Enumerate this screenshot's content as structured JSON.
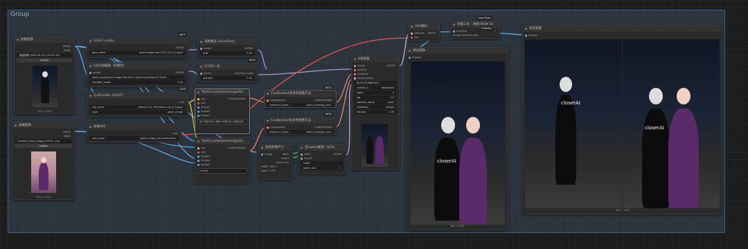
{
  "group": {
    "title": "Group"
  },
  "badges": {
    "gguf": "gguf",
    "beta1": "BETA",
    "beta2": "BETA",
    "beta3": "BETA",
    "layerstyle": "LayerStyle",
    "icnodes": "ICNodes",
    "gguf2": "GGUF"
  },
  "load_image1": {
    "title": "加载图像",
    "out_image": "IMAGE",
    "out_mask": "MASK",
    "file": "鼎盛视频_2025-08-16_0:25:22.78...",
    "upload": "upload",
    "size": "704 × 1216"
  },
  "load_image2": {
    "title": "加载图像",
    "id": "#0.2 DCC",
    "out_image": "IMAGE",
    "out_mask": "MASK",
    "file": "ComfyUI_temp_bbqqq_00010_.png",
    "upload": "upload",
    "size": "704 × 1216"
  },
  "gguf_loader": {
    "title": "GGUF Loader",
    "out": "MODEL",
    "field": "gguf_name",
    "value": "qwen-image-edit-2511-Q4_K_S.gguf"
  },
  "lora_loader": {
    "title": "LoRA加载器（仅模型）",
    "in": "model",
    "out": "MODEL",
    "lora": "qwen-local/Qwen-Image-Edit-2511-Lightning-4steps-V1.0-bf1...",
    "strength_label": "strength_model",
    "strength": "1.00"
  },
  "clip_loader": {
    "title": "CLIPLoader (GGUF)",
    "out": "CLIP",
    "clip_label": "clip_name",
    "clip": "Qwen2.5-VL-7B-Instruct-Q4_K_S.gguf",
    "type_label": "type",
    "type": "qwen_image"
  },
  "vae_loader": {
    "title": "加载VAE",
    "out": "VAE",
    "field": "vae_name",
    "value": "qwen_image_vae.safetensors"
  },
  "aura_flow": {
    "title": "采样算法 (AuraFlow)",
    "in": "model",
    "out": "MODEL",
    "shift_label": "shift",
    "shift": "3.00"
  },
  "cfg_norm": {
    "title": "CFG归一化",
    "in": "model",
    "out": "patched_model",
    "strength_label": "strength",
    "strength": "1.00"
  },
  "text_encode1": {
    "title": "TextEncodeQwenImageEdi...",
    "in_clip": "clip",
    "in_vae": "vae",
    "in_image1": "image1",
    "in_image2": "image2",
    "in_image3": "image3",
    "out": "CONDITIONING",
    "prompt": "将1号图中的人物和2号图中的人物放在同一场景中，两人比心...（中文）"
  },
  "text_encode2": {
    "title": "TextEncodeQwenImageEdi...",
    "in_clip": "clip",
    "in_vae": "vae",
    "in_image1": "image1",
    "in_image2": "image2",
    "in_image3": "image3",
    "out": "CONDITIONING",
    "prompt": "prompt"
  },
  "flux_ref1": {
    "title": "FluxKontext多参考图像方法",
    "in": "conditioning",
    "out": "CONDITIONING",
    "method_label": "reference_laten...",
    "method": "index_timestep_zero"
  },
  "flux_ref2": {
    "title": "FluxKontext多参考图像方法",
    "in": "conditioning",
    "out": "CONDITIONING",
    "method_label": "reference_laten...",
    "method": "index_timestep_zero"
  },
  "image_size": {
    "title": "获取图像尺寸",
    "in": "image",
    "out_w": "width",
    "out_h": "height",
    "out_b": "batch_size",
    "width_label": "width:",
    "width": "768_h",
    "height_label": "eight:",
    "height": "1376"
  },
  "empty_latent": {
    "title": "空Latent图像（SD3）",
    "in_w": "width",
    "in_h": "height",
    "out": "LATENT",
    "w_label": "width",
    "h_label": "height",
    "batch_label": "batch_size",
    "batch": "1"
  },
  "ksampler": {
    "title": "K采样器",
    "in_model": "model",
    "in_pos": "positive",
    "in_neg": "negative",
    "in_latent": "latent_image",
    "out": "LATENT",
    "seed": "823312156890017",
    "control_label": "control_a...",
    "control": "randomize",
    "steps_label": "steps",
    "steps": "4",
    "cfg_label": "cfg",
    "cfg": "1.0",
    "sampler_label": "sampler_name",
    "sampler": "euler",
    "scheduler_label": "scheduler",
    "scheduler": "simple",
    "denoise_label": "denoise",
    "denoise": "1.00"
  },
  "vae_decode": {
    "title": "VAE解码",
    "in_samples": "samples",
    "in_vae": "vae",
    "out": "IMAGE"
  },
  "clean_vram": {
    "title": "清理工具 - 清除VRAM V2",
    "id": "#5.3 MB",
    "in": "anything",
    "out": "*",
    "field": "image Concatenated"
  },
  "preview1": {
    "title": "预览图像",
    "in": "images",
    "size": "768 × 1376"
  },
  "preview2": {
    "title": "预览图像",
    "in": "images",
    "size": "768 × 1376"
  },
  "scene": {
    "shirt_text": "closerAI"
  }
}
